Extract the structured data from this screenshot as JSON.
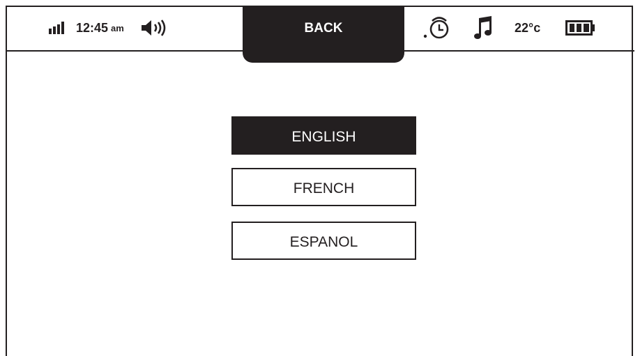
{
  "status_bar": {
    "time": "12:45",
    "ampm": "am",
    "temperature": "22°c",
    "icons": [
      "signal-icon",
      "speaker-icon",
      "alarm-clock-icon",
      "music-note-icon",
      "battery-icon"
    ]
  },
  "back_label": "BACK",
  "languages": [
    {
      "label": "ENGLISH",
      "selected": true
    },
    {
      "label": "FRENCH",
      "selected": false
    },
    {
      "label": "ESPANOL",
      "selected": false
    }
  ],
  "colors": {
    "foreground": "#231f20",
    "background": "#ffffff"
  }
}
